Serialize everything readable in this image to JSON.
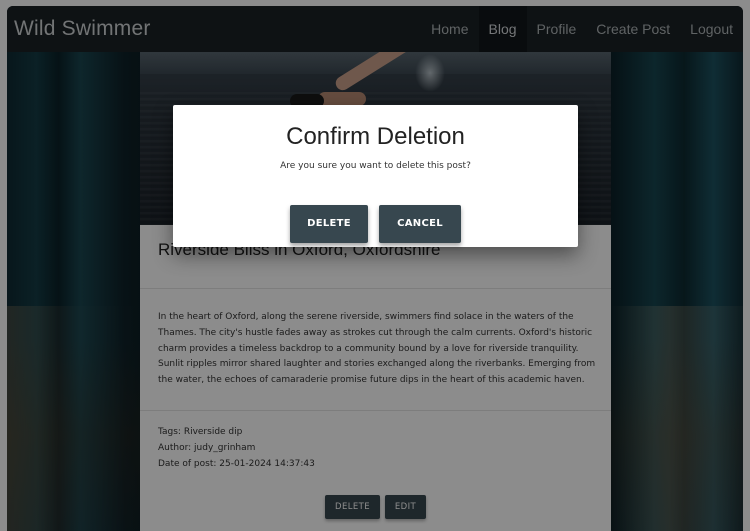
{
  "navbar": {
    "brand": "Wild Swimmer",
    "links": [
      {
        "label": "Home",
        "active": false
      },
      {
        "label": "Blog",
        "active": true
      },
      {
        "label": "Profile",
        "active": false
      },
      {
        "label": "Create Post",
        "active": false
      },
      {
        "label": "Logout",
        "active": false
      }
    ]
  },
  "post": {
    "title": "Riverside Bliss in Oxford, Oxfordshire",
    "body": "In the heart of Oxford, along the serene riverside, swimmers find solace in the waters of the Thames. The city's hustle fades away as strokes cut through the calm currents. Oxford's historic charm provides a timeless backdrop to a community bound by a love for riverside tranquility. Sunlit ripples mirror shared laughter and stories exchanged along the riverbanks. Emerging from the water, the echoes of camaraderie promise future dips in the heart of this academic haven.",
    "tags": "Tags: Riverside dip",
    "author": "Author: judy_grinham",
    "date": "Date of post: 25-01-2024 14:37:43",
    "delete_label": "DELETE",
    "edit_label": "EDIT"
  },
  "modal": {
    "title": "Confirm Deletion",
    "message": "Are you sure you want to delete this post?",
    "delete_label": "DELETE",
    "cancel_label": "CANCEL"
  },
  "colors": {
    "navbar_bg": "#1b2125",
    "button_bg": "#37474f"
  }
}
